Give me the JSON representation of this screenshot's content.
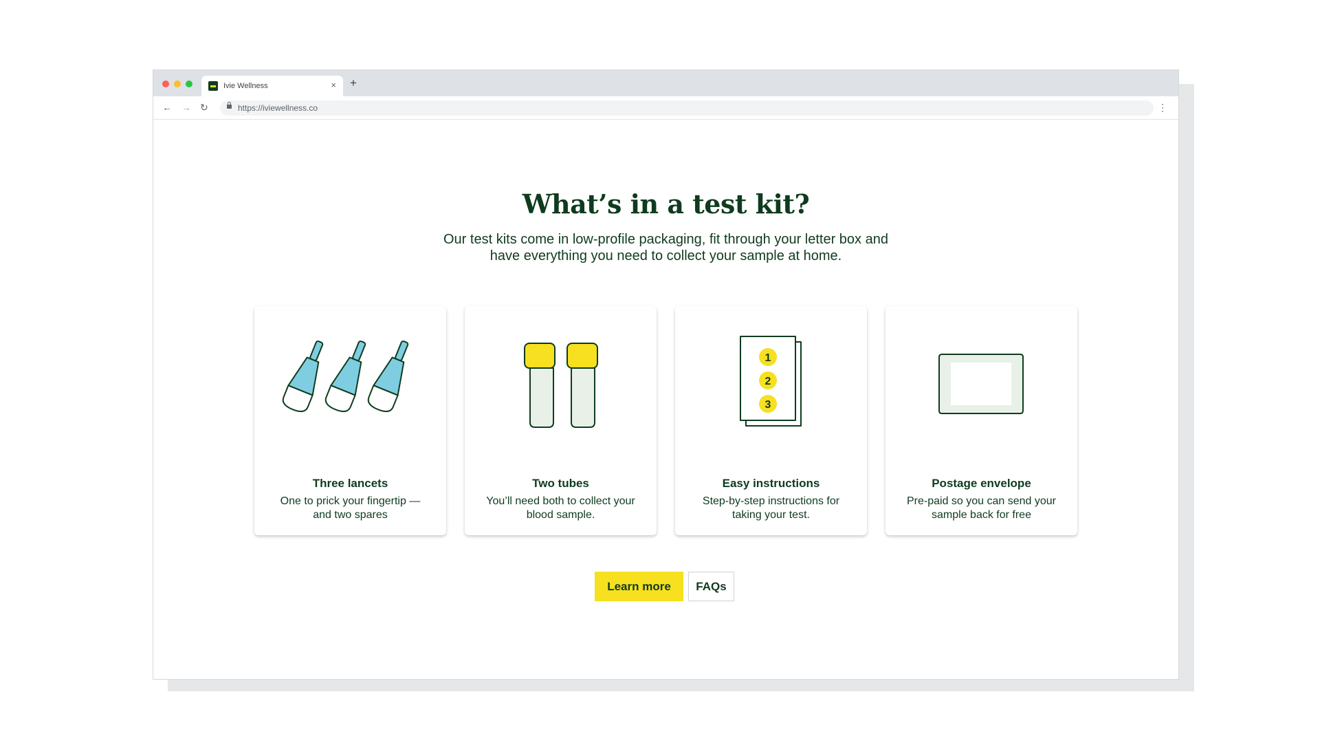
{
  "browser": {
    "tab_title": "Ivie Wellness",
    "tab_close": "×",
    "new_tab": "+",
    "url": "https://iviewellness.co",
    "nav": {
      "back": "←",
      "forward": "→",
      "reload": "↻",
      "menu": "⋮"
    }
  },
  "heading": "What’s in a test kit?",
  "subtitle": {
    "line1": "Our test kits come in low-profile packaging, fit through your letter box and",
    "line2": "have everything you need to collect your sample at home."
  },
  "cards": [
    {
      "icon": "lancets-icon",
      "title": "Three lancets",
      "desc_line1": "One to prick your fingertip —",
      "desc_line2": "and two spares"
    },
    {
      "icon": "tubes-icon",
      "title": "Two tubes",
      "desc_line1": "You’ll need both to collect your",
      "desc_line2": "blood sample."
    },
    {
      "icon": "instructions-icon",
      "title": "Easy instructions",
      "desc_line1": "Step-by-step instructions for",
      "desc_line2": "taking your test.",
      "steps": [
        "1",
        "2",
        "3"
      ]
    },
    {
      "icon": "envelope-icon",
      "title": "Postage envelope",
      "desc_line1": "Pre-paid so you can send your",
      "desc_line2": "sample back for free"
    }
  ],
  "buttons": {
    "primary": "Learn more",
    "secondary": "FAQs"
  },
  "colors": {
    "brand_dark_green": "#0f3b1e",
    "accent_yellow": "#f6e020",
    "lancet_blue": "#7fcde0",
    "tube_body": "#e8f0e8"
  }
}
